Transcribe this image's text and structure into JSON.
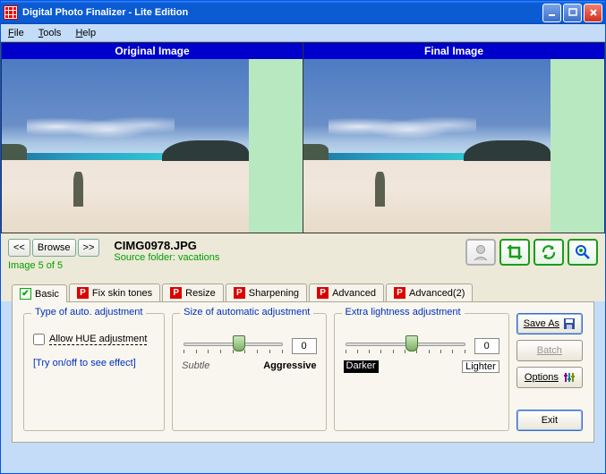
{
  "title": "Digital Photo Finalizer - Lite Edition",
  "menu": {
    "file": "File",
    "tools": "Tools",
    "help": "Help"
  },
  "panels": {
    "original": "Original Image",
    "final": "Final Image"
  },
  "nav": {
    "prev": "<<",
    "browse": "Browse",
    "next": ">>"
  },
  "file": {
    "name": "CIMG0978.JPG",
    "source": "Source folder: vacations",
    "count": "Image 5 of 5"
  },
  "tabs": {
    "basic": "Basic",
    "skin": "Fix skin tones",
    "resize": "Resize",
    "sharpen": "Sharpening",
    "advanced": "Advanced",
    "advanced2": "Advanced(2)"
  },
  "fieldsets": {
    "type": {
      "title": "Type of auto. adjustment",
      "checkbox": "Allow HUE adjustment",
      "hint": "[Try on/off to see effect]"
    },
    "size": {
      "title": "Size of automatic adjustment",
      "value": "0",
      "left": "Subtle",
      "right": "Aggressive"
    },
    "extra": {
      "title": "Extra lightness adjustment",
      "value": "0",
      "left": "Darker",
      "right": "Lighter"
    }
  },
  "buttons": {
    "saveas": "Save As",
    "batch": "Batch",
    "options": "Options",
    "exit": "Exit"
  }
}
